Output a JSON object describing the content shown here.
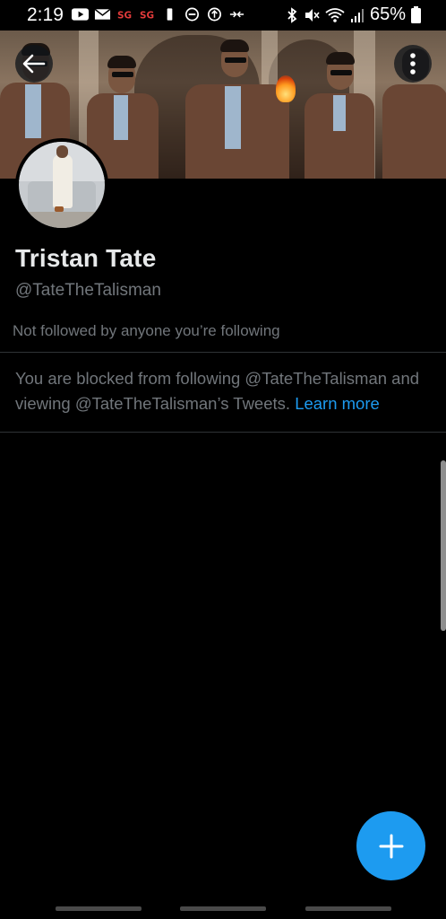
{
  "status_bar": {
    "time": "2:19",
    "battery": "65%",
    "icons": [
      "youtube-icon",
      "mail-icon",
      "sg-app-icon",
      "sg-app-icon",
      "battery-saver-icon",
      "do-not-disturb-icon",
      "data-saver-icon",
      "cast-icon",
      "bluetooth-icon",
      "mute-icon",
      "wifi-icon",
      "signal-icon",
      "battery-icon"
    ]
  },
  "header": {
    "back_icon": "arrow-left-icon",
    "more_icon": "more-vertical-icon"
  },
  "profile": {
    "name": "Tristan Tate",
    "handle": "@TateTheTalisman",
    "followers_note": "Not followed by anyone you’re following"
  },
  "blocked_notice": {
    "text": "You are blocked from following @TateTheTalisman and viewing @TateTheTalisman’s Tweets.",
    "link_label": "Learn more"
  },
  "fab": {
    "icon": "plus-icon"
  },
  "colors": {
    "background": "#000000",
    "accent": "#1d9bf0",
    "secondary_text": "#71767b",
    "divider": "#2f3336"
  }
}
